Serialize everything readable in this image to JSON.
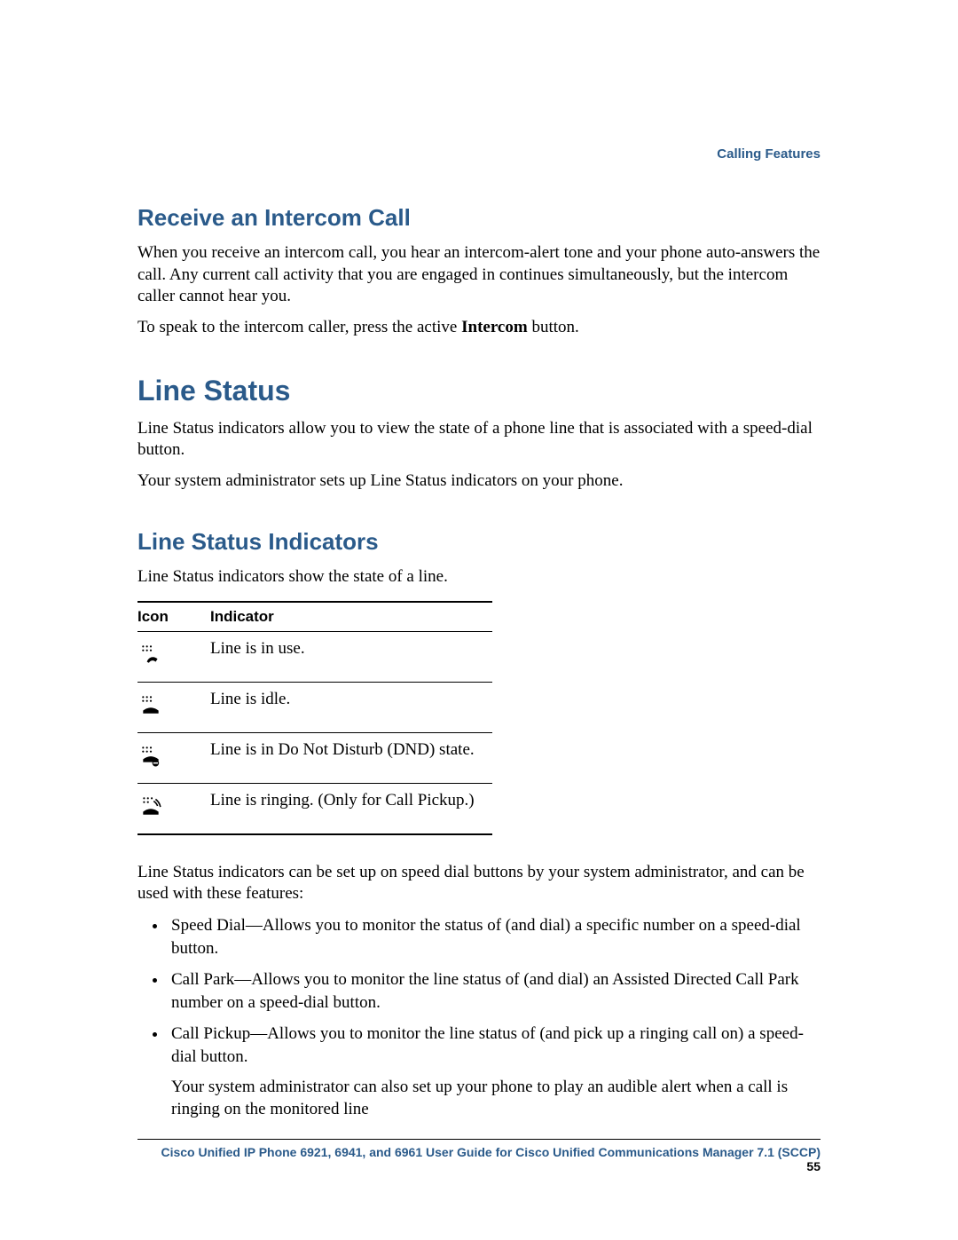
{
  "header": {
    "section_label": "Calling Features"
  },
  "intercom": {
    "heading": "Receive an Intercom Call",
    "p1": "When you receive an intercom call, you hear an intercom-alert tone and your phone auto-answers the call. Any current call activity that you are engaged in continues simultaneously, but the intercom caller cannot hear you.",
    "p2_prefix": "To speak to the intercom caller, press the active ",
    "p2_bold": "Intercom",
    "p2_suffix": " button."
  },
  "line_status": {
    "heading": "Line Status",
    "p1": "Line Status indicators allow you to view the state of a phone line that is associated with a speed-dial button.",
    "p2": "Your system administrator sets up Line Status indicators on your phone."
  },
  "indicators": {
    "heading": "Line Status Indicators",
    "intro": "Line Status indicators show the state of a line.",
    "table": {
      "col_icon": "Icon",
      "col_indicator": "Indicator",
      "rows": [
        {
          "icon": "line-in-use-icon",
          "text": "Line is in use."
        },
        {
          "icon": "line-idle-icon",
          "text": "Line is idle."
        },
        {
          "icon": "line-dnd-icon",
          "text": "Line is in Do Not Disturb (DND) state."
        },
        {
          "icon": "line-ringing-icon",
          "text": "Line is ringing. (Only for Call Pickup.)"
        }
      ]
    },
    "after_table": "Line Status indicators can be set up on speed dial buttons by your system administrator, and can be used with these features:",
    "features": [
      {
        "text": "Speed Dial—Allows you to monitor the status of (and dial) a specific number on a speed-dial button."
      },
      {
        "text": "Call Park—Allows you to monitor the line status of (and dial) an Assisted Directed Call Park number on a speed-dial button."
      },
      {
        "text": "Call Pickup—Allows you to monitor the line status of (and pick up a ringing call on) a speed-dial button.",
        "note": "Your system administrator can also set up your phone to play an audible alert when a call is ringing on the monitored line"
      }
    ]
  },
  "footer": {
    "title": "Cisco Unified IP Phone 6921, 6941, and 6961 User Guide for Cisco Unified Communications Manager 7.1 (SCCP)",
    "page": "55"
  }
}
